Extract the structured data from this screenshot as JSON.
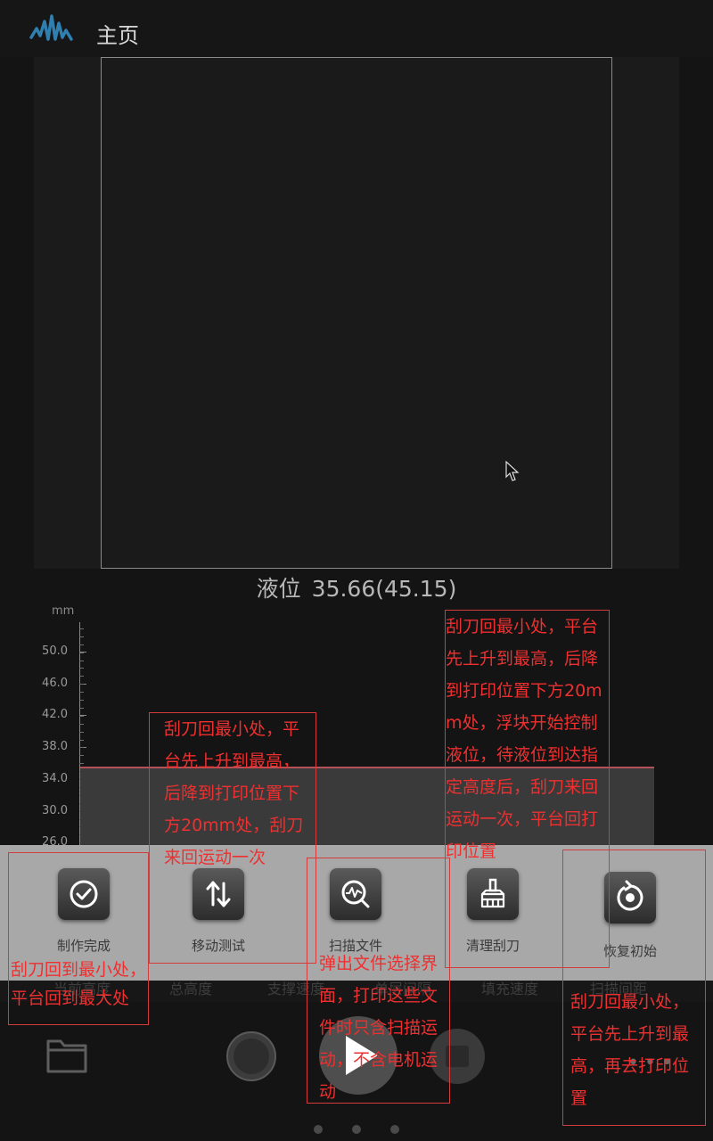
{
  "header": {
    "title": "主页"
  },
  "liquid": {
    "label": "液位",
    "value": "35.66(45.15)"
  },
  "chart_data": {
    "type": "area",
    "ylabel": "mm",
    "y_ticks": [
      "50.0",
      "46.0",
      "42.0",
      "38.0",
      "34.0",
      "30.0",
      "26.0"
    ],
    "series": [
      {
        "values": [
          35.66,
          35.66
        ]
      }
    ],
    "grid": false
  },
  "stats": [
    "当前高度",
    "总高度",
    "支撑速度",
    "单层间隔",
    "填充速度",
    "扫描间距"
  ],
  "menu": [
    {
      "label": "制作完成",
      "icon": "check-circle-icon"
    },
    {
      "label": "移动测试",
      "icon": "up-down-arrows-icon"
    },
    {
      "label": "扫描文件",
      "icon": "scan-search-icon"
    },
    {
      "label": "清理刮刀",
      "icon": "brush-icon"
    },
    {
      "label": "恢复初始",
      "icon": "reset-icon"
    }
  ],
  "notes": {
    "complete": "刮刀回到最小处，平台回到最大处",
    "move_test": "刮刀回最小处，平台先上升到最高，后降到打印位置下方20mm处，刮刀来回运动一次",
    "scan_file": "弹出文件选择界面，打印这些文件时只含扫描运动，不含电机运动",
    "clean_blade": "刮刀回最小处，平台先上升到最高，后降到打印位置下方20mm处，浮块开始控制液位，待液位到达指定高度后，刮刀来回运动一次，平台回打印位置",
    "reset": "刮刀回最小处，平台先上升到最高，再去打印位置"
  },
  "colors": {
    "annotation": "#ee3030",
    "level_line": "#b45058"
  }
}
